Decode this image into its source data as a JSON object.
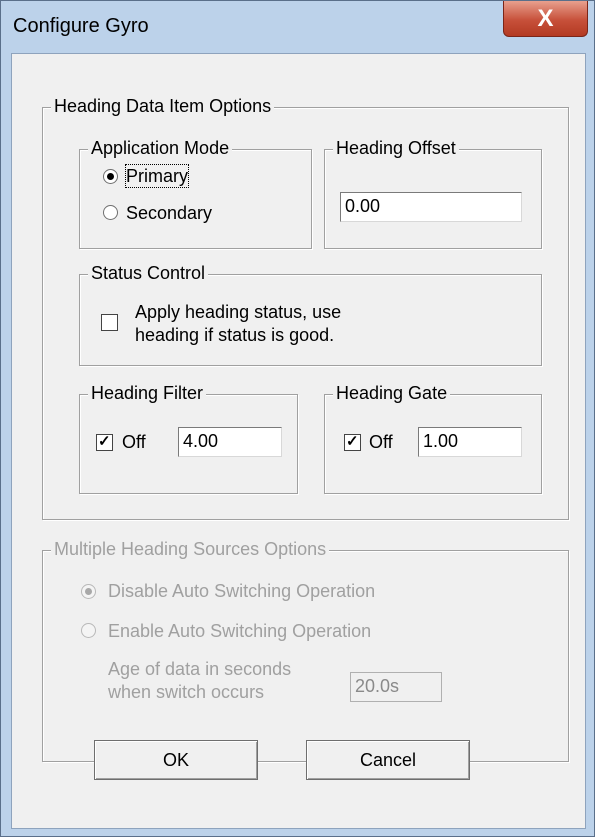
{
  "window": {
    "title": "Configure Gyro",
    "close_glyph": "X"
  },
  "heading_options": {
    "title": "Heading Data Item Options",
    "application_mode": {
      "title": "Application Mode",
      "primary_label": "Primary",
      "secondary_label": "Secondary",
      "selected": "Primary"
    },
    "heading_offset": {
      "title": "Heading Offset",
      "value": "0.00"
    },
    "status_control": {
      "title": "Status Control",
      "checkbox_line1": "Apply heading status, use",
      "checkbox_line2": "heading if status is good.",
      "checked": false
    },
    "heading_filter": {
      "title": "Heading Filter",
      "off_label": "Off",
      "off_checked": true,
      "value": "4.00"
    },
    "heading_gate": {
      "title": "Heading Gate",
      "off_label": "Off",
      "off_checked": true,
      "value": "1.00"
    }
  },
  "multiple_sources": {
    "title": "Multiple Heading Sources Options",
    "disable_label": "Disable Auto Switching Operation",
    "enable_label": "Enable Auto Switching Operation",
    "selected": "Disable Auto Switching Operation",
    "age_label_line1": "Age of data in seconds",
    "age_label_line2": "when switch occurs",
    "age_value": "20.0s",
    "enabled": false
  },
  "buttons": {
    "ok_label": "OK",
    "cancel_label": "Cancel"
  },
  "colors": {
    "frame_border": "#5a6f8a",
    "close_button": "#c7503a",
    "dialog_bg": "#f0f0f0",
    "disabled_text": "#a0a0a0"
  },
  "icons": {
    "close": "close-icon",
    "radio": "radio-button",
    "checkbox": "checkbox-check"
  }
}
